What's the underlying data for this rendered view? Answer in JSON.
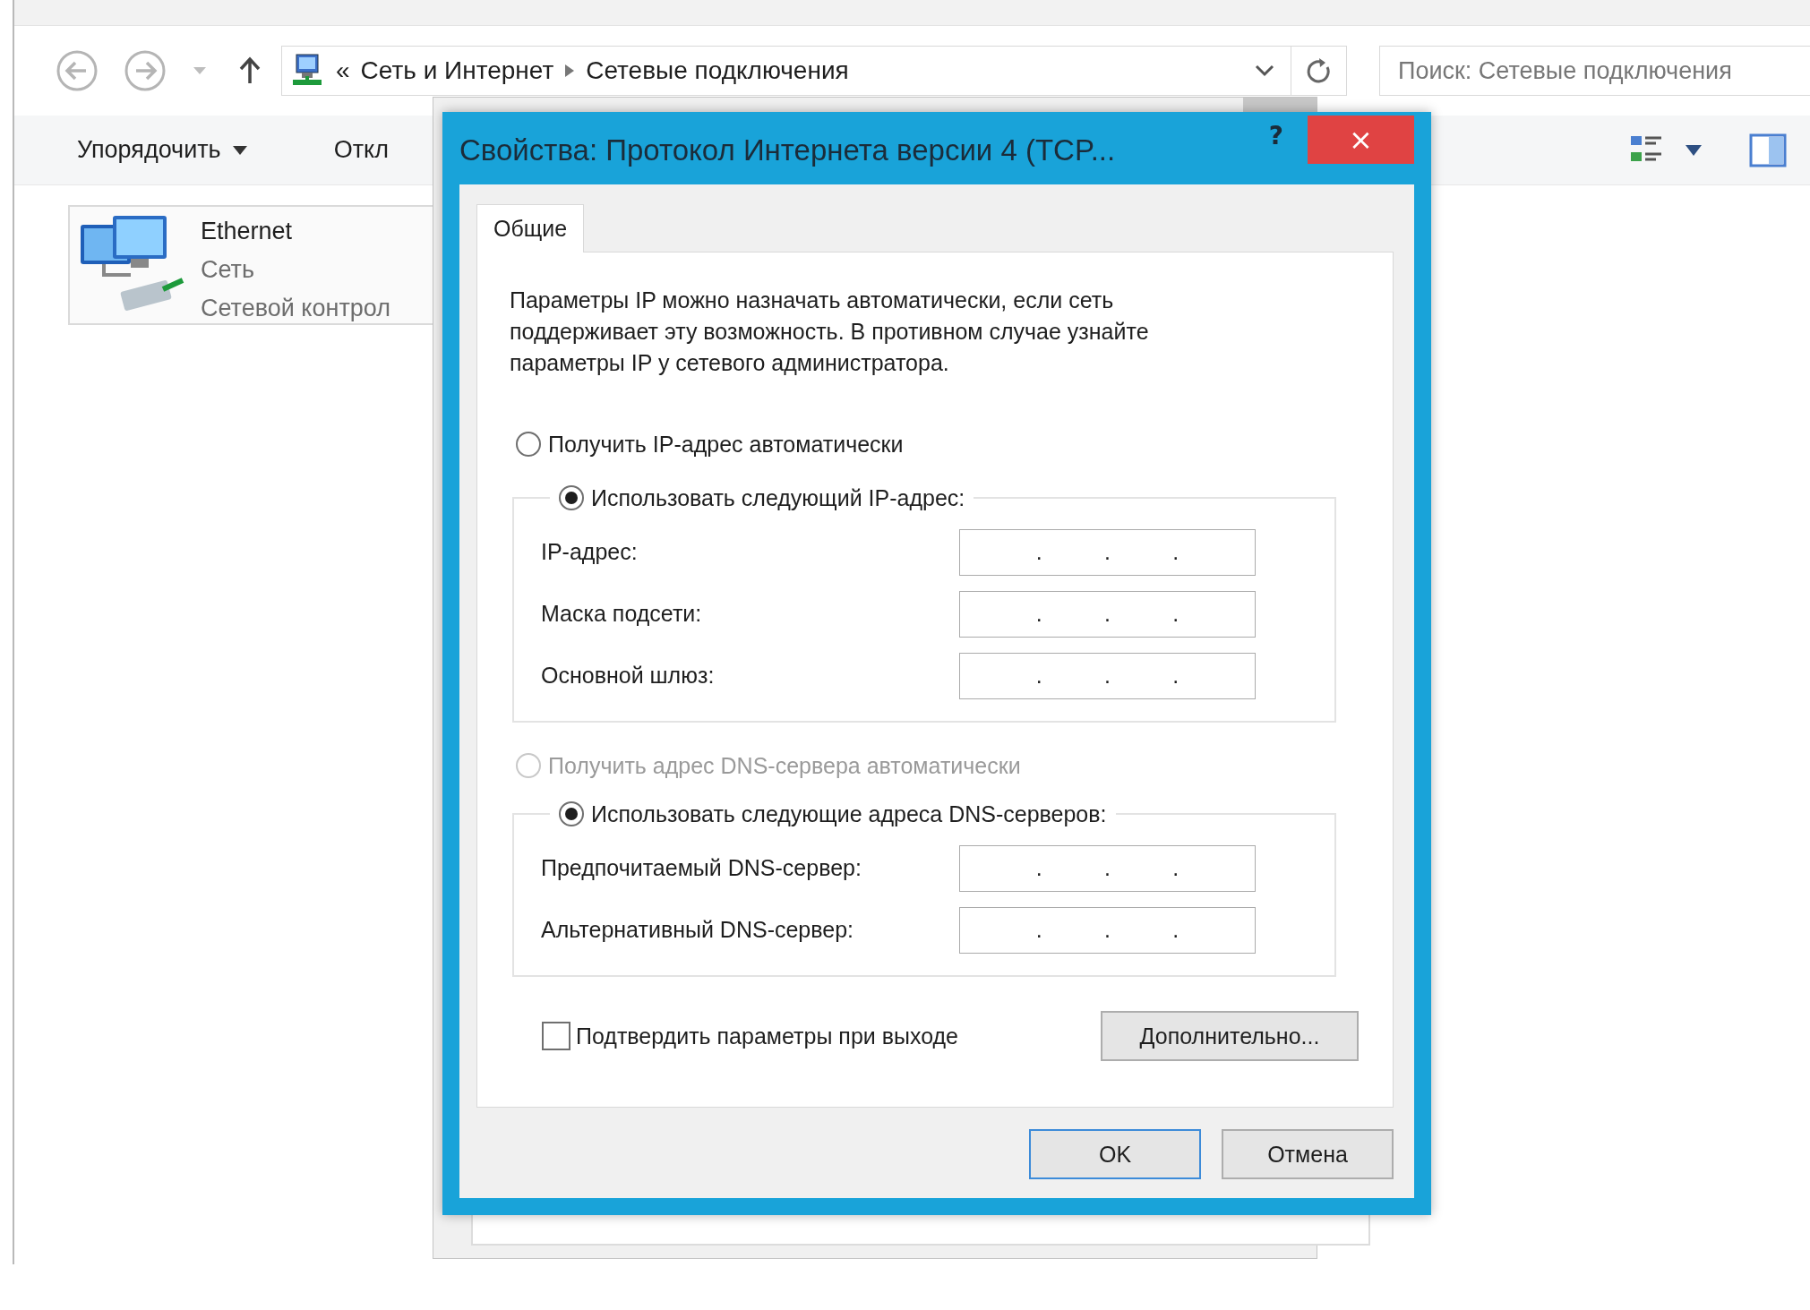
{
  "explorer": {
    "address": {
      "prefix": "«",
      "path": [
        "Сеть и Интернет",
        "Сетевые подключения"
      ]
    },
    "search": {
      "placeholder": "Поиск: Сетевые подключения"
    },
    "toolbar": [
      "Упорядочить",
      "Откл"
    ],
    "items": [
      {
        "name": "Ethernet",
        "lines": [
          "Сеть",
          "Сетевой контрол"
        ]
      }
    ]
  },
  "dialog": {
    "title": "Свойства: Протокол Интернета версии 4 (TCP...",
    "help": "?",
    "close": "×",
    "tabs": [
      {
        "label": "Общие",
        "selected": true
      }
    ],
    "description": "Параметры IP можно назначать автоматически, если сеть поддерживает эту возможность. В противном случае узнайте параметры IP у сетевого администратора.",
    "ip_separator": ".",
    "ip_auto": {
      "label": "Получить IP-адрес автоматически",
      "selected": false,
      "disabled": false
    },
    "ip_manual": {
      "label": "Использовать следующий IP-адрес:",
      "selected": true,
      "disabled": false
    },
    "ip_fields": [
      {
        "label": "IP-адрес:",
        "disabled": false
      },
      {
        "label": "Маска подсети:",
        "disabled": false
      },
      {
        "label": "Основной шлюз:",
        "disabled": false
      }
    ],
    "dns_auto": {
      "label": "Получить адрес DNS-сервера автоматически",
      "selected": false,
      "disabled": true
    },
    "dns_manual": {
      "label": "Использовать следующие адреса DNS-серверов:",
      "selected": true,
      "disabled": false
    },
    "dns_fields": [
      {
        "label": "Предпочитаемый DNS-сервер:",
        "disabled": false
      },
      {
        "label": "Альтернативный DNS-сервер:",
        "disabled": false
      }
    ],
    "validate": {
      "label": "Подтвердить параметры при выходе",
      "checked": false
    },
    "advanced_button": "Дополнительно...",
    "buttons": [
      {
        "label": "OK",
        "default": true
      },
      {
        "label": "Отмена",
        "default": false
      }
    ]
  }
}
